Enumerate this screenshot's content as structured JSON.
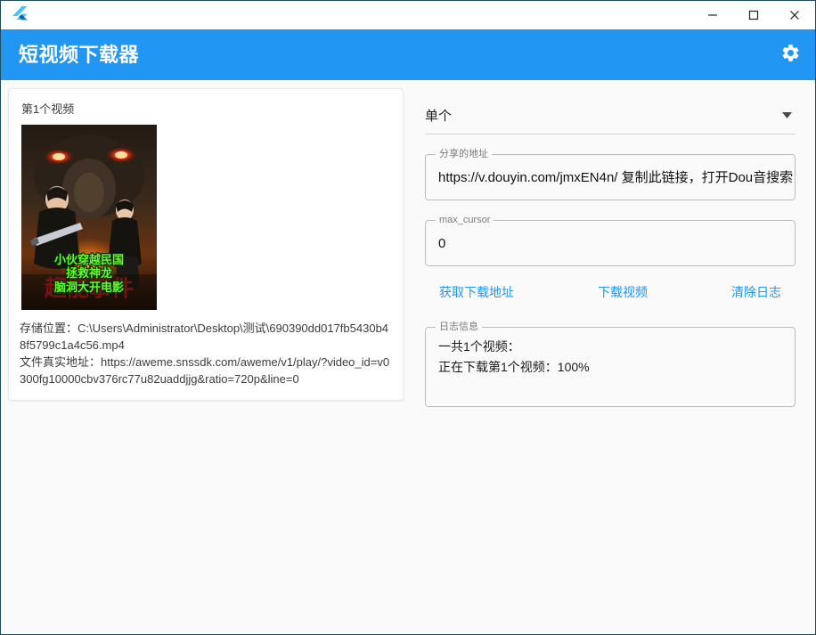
{
  "window": {
    "logo_icon": "flutter-logo-icon",
    "controls": [
      {
        "name": "minimize",
        "icon": "minimize-icon"
      },
      {
        "name": "maximize",
        "icon": "maximize-icon"
      },
      {
        "name": "close",
        "icon": "close-icon"
      }
    ]
  },
  "appbar": {
    "title": "短视频下载器",
    "settings_icon": "gear-icon",
    "background": "#2196f3",
    "foreground": "#ffffff"
  },
  "left_panel": {
    "video_index_label": "第1个视频",
    "thumbnail": {
      "alt": "movie-poster-thumbnail",
      "overlay_lines": [
        "小伙穿越民国",
        "拯救神龙",
        "脑洞大开电影"
      ],
      "overlay_color": "#6dfb3d",
      "bottom_title": "超能事件"
    },
    "storage_line": "存储位置：C:\\Users\\Administrator\\Desktop\\测试\\690390dd017fb5430b48f5799c1a4c56.mp4",
    "real_url_line": "文件真实地址：https://aweme.snssdk.com/aweme/v1/play/?video_id=v0300fg10000cbv376rc77u82uaddjjg&ratio=720p&line=0"
  },
  "right_panel": {
    "mode_select": {
      "label": "mode-select",
      "value": "单个",
      "options": [
        "单个"
      ],
      "arrow_icon": "chevron-down-icon"
    },
    "share_url_field": {
      "label": "分享的地址",
      "value": "https://v.douyin.com/jmxEN4n/ 复制此链接，打开Dou音搜索，直接观看视频！",
      "placeholder": ""
    },
    "max_cursor_field": {
      "label": "max_cursor",
      "value": "0",
      "placeholder": ""
    },
    "buttons": [
      {
        "name": "get-download-url-button",
        "label": "获取下载地址"
      },
      {
        "name": "download-video-button",
        "label": "下载视频"
      },
      {
        "name": "clear-log-button",
        "label": "清除日志"
      }
    ],
    "button_color": "#2196f3",
    "log_field": {
      "label": "日志信息",
      "lines": [
        "一共1个视频：",
        "正在下载第1个视频：100%"
      ]
    }
  }
}
